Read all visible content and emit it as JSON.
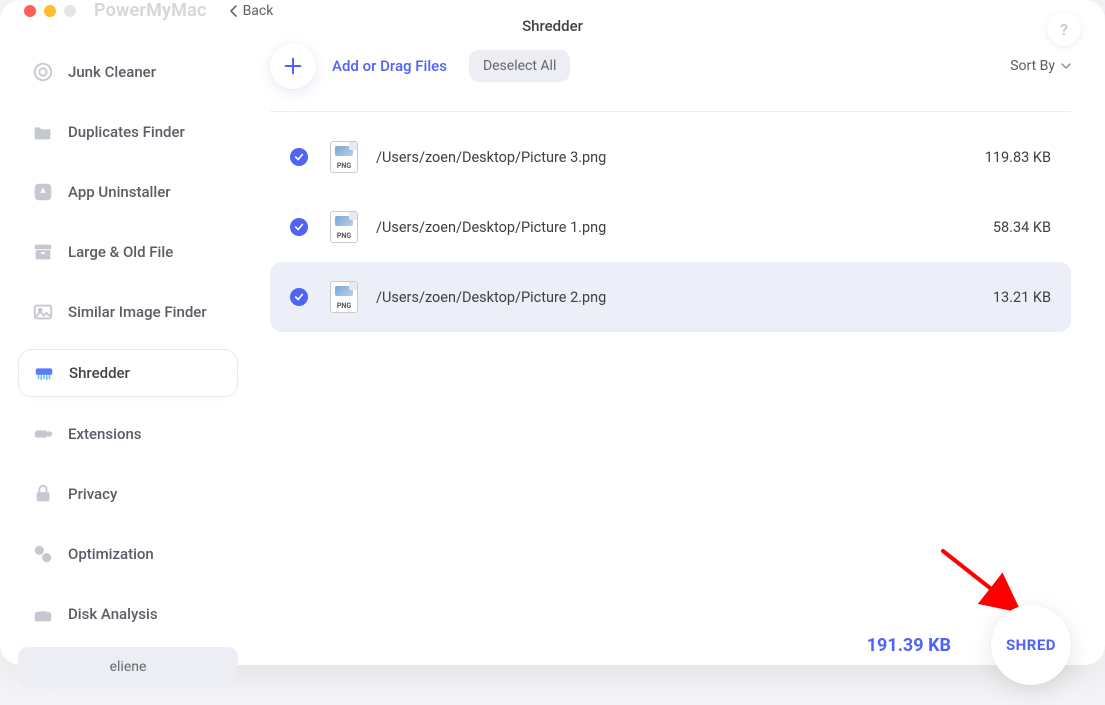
{
  "app_name": "PowerMyMac",
  "back_label": "Back",
  "page_title": "Shredder",
  "help_symbol": "?",
  "sidebar": {
    "items": [
      {
        "label": "Junk Cleaner"
      },
      {
        "label": "Duplicates Finder"
      },
      {
        "label": "App Uninstaller"
      },
      {
        "label": "Large & Old File"
      },
      {
        "label": "Similar Image Finder"
      },
      {
        "label": "Shredder"
      },
      {
        "label": "Extensions"
      },
      {
        "label": "Privacy"
      },
      {
        "label": "Optimization"
      },
      {
        "label": "Disk Analysis"
      }
    ],
    "user": "eliene"
  },
  "toolbar": {
    "add_label": "Add or Drag Files",
    "deselect_label": "Deselect All",
    "sort_label": "Sort By"
  },
  "files": [
    {
      "path": "/Users/zoen/Desktop/Picture 3.png",
      "size": "119.83 KB",
      "type_label": "PNG"
    },
    {
      "path": "/Users/zoen/Desktop/Picture 1.png",
      "size": "58.34 KB",
      "type_label": "PNG"
    },
    {
      "path": "/Users/zoen/Desktop/Picture 2.png",
      "size": "13.21 KB",
      "type_label": "PNG"
    }
  ],
  "total_size": "191.39 KB",
  "shred_label": "SHRED"
}
